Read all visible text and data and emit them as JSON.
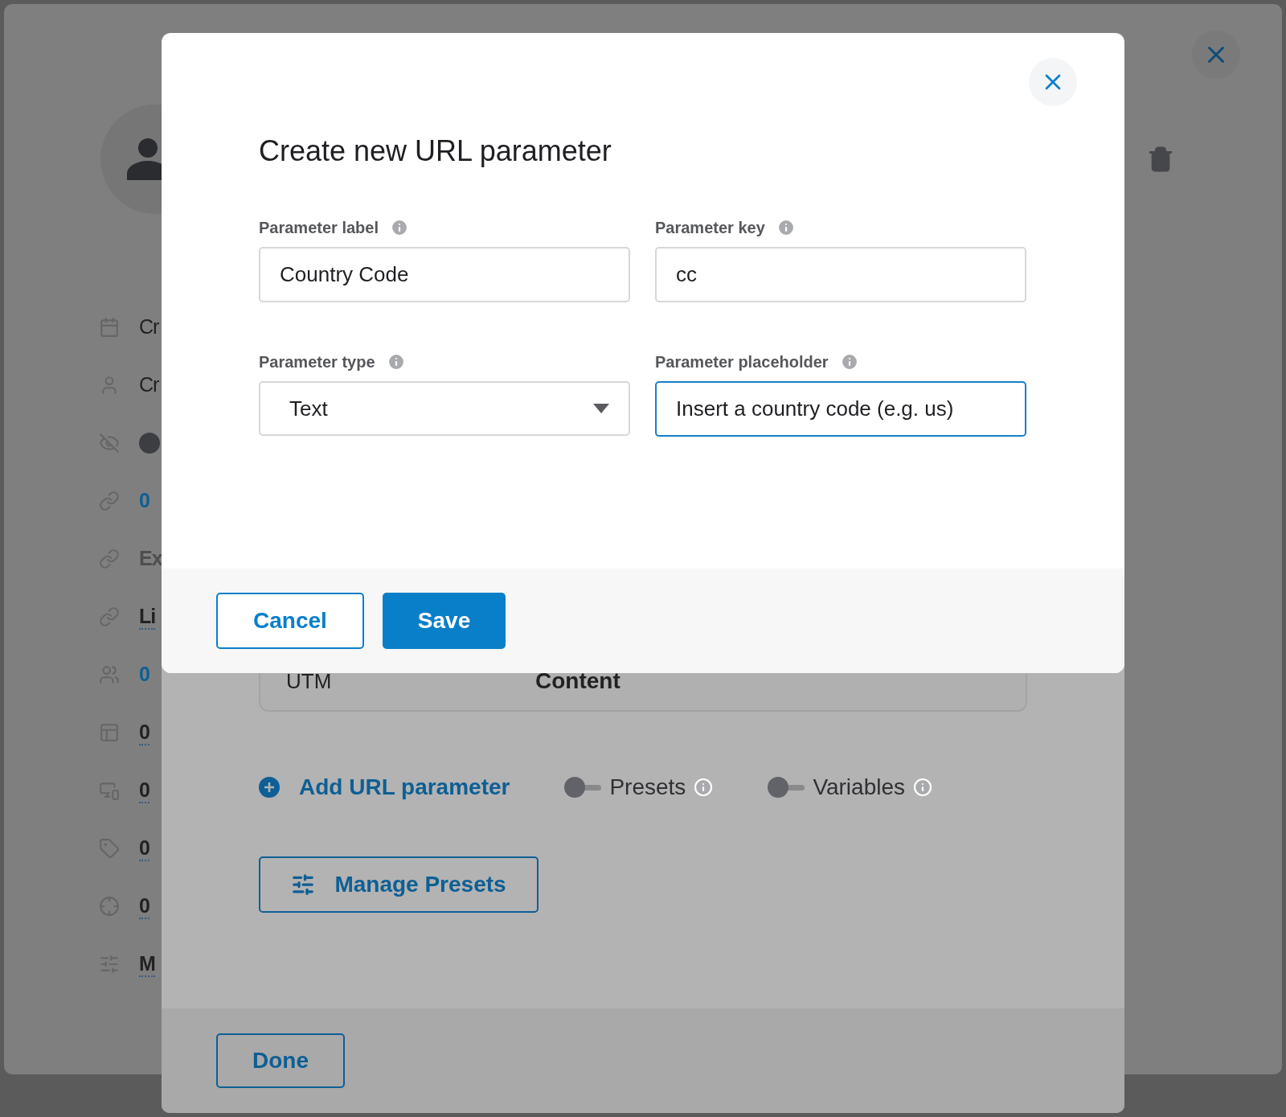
{
  "sidebar": {
    "items": [
      {
        "kind": "text",
        "text": "Cr"
      },
      {
        "kind": "text",
        "text": "Cr"
      },
      {
        "kind": "dot"
      },
      {
        "kind": "count",
        "text": "0"
      },
      {
        "kind": "muted",
        "text": "Ex"
      },
      {
        "kind": "link",
        "text": "Li"
      },
      {
        "kind": "count",
        "text": "0"
      },
      {
        "kind": "link",
        "text": "0"
      },
      {
        "kind": "link",
        "text": "0"
      },
      {
        "kind": "link",
        "text": "0"
      },
      {
        "kind": "link",
        "text": "0"
      },
      {
        "kind": "link",
        "text": "M"
      }
    ]
  },
  "url_panel": {
    "table": {
      "column_1": "UTM",
      "column_2": "Content"
    },
    "add_link": "Add URL parameter",
    "toggles": [
      {
        "label": "Presets",
        "on": false
      },
      {
        "label": "Variables",
        "on": false
      }
    ],
    "manage_button": "Manage Presets",
    "done_button": "Done"
  },
  "modal": {
    "title": "Create new URL parameter",
    "fields": [
      {
        "label": "Parameter label",
        "kind": "input",
        "value": "Country Code",
        "focused": false
      },
      {
        "label": "Parameter key",
        "kind": "input",
        "value": "cc",
        "focused": false
      },
      {
        "label": "Parameter type",
        "kind": "select",
        "value": "Text",
        "focused": false
      },
      {
        "label": "Parameter placeholder",
        "kind": "input",
        "value": "Insert a country code (e.g. us)",
        "focused": true
      }
    ],
    "buttons": [
      {
        "label": "Cancel",
        "kind": "secondary"
      },
      {
        "label": "Save",
        "kind": "primary"
      }
    ]
  }
}
